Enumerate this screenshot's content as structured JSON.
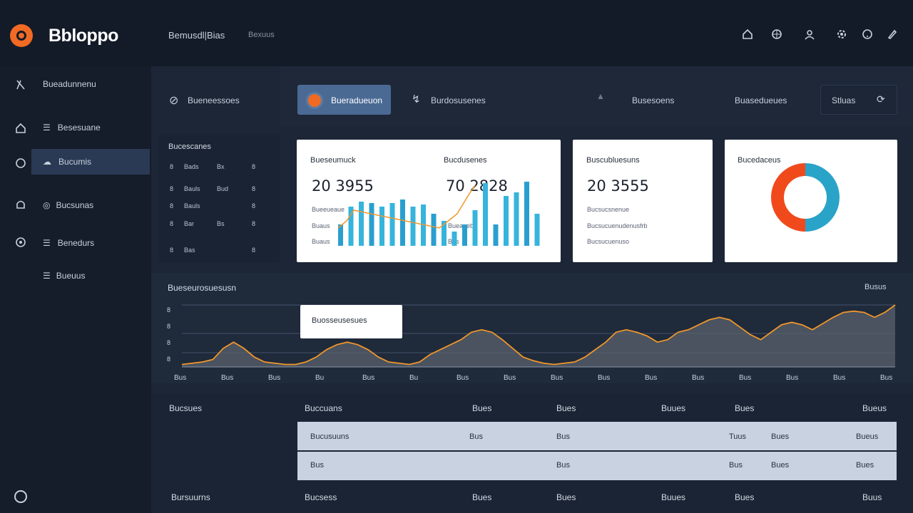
{
  "header": {
    "logo_text": "Bbloppo",
    "breadcrumb": [
      "Bemusdl|Bias",
      "Bexuus"
    ],
    "icons": [
      "home-icon",
      "globe-icon",
      "user-icon",
      "settings-icon",
      "help-icon",
      "edit-icon"
    ]
  },
  "sidebar": {
    "items": [
      {
        "label": "Bueadunnenu",
        "icon": "compass-icon"
      },
      {
        "label": "Besesuane",
        "icon": "home-icon"
      },
      {
        "label": "Bucumis",
        "icon": "cloud-icon"
      },
      {
        "label": "Bucsunas",
        "icon": "bell-icon"
      },
      {
        "label": "Benedurs",
        "icon": "globe-icon"
      },
      {
        "label": "Bueuus",
        "icon": "list-icon"
      }
    ]
  },
  "tabs": {
    "items": [
      "Bueneessoes",
      "Bueradueuon",
      "Burdosusenes",
      "Busesoens",
      "Buasedueues",
      "Stluas"
    ]
  },
  "list_panel": {
    "title": "Bucescanes",
    "rows": [
      [
        "8",
        "Bads",
        "Bx",
        "8"
      ],
      [
        "8",
        "Bauls",
        "Bud",
        "8"
      ],
      [
        "8",
        "Bauls",
        "",
        "8"
      ],
      [
        "8",
        "Bar",
        "Bs",
        "8"
      ],
      [
        "8",
        "Bas",
        "",
        "8"
      ]
    ]
  },
  "cards": {
    "metric_1": {
      "label": "Bueseumuck",
      "value": "20 3955",
      "subs": [
        "Bueeueaue",
        "Buaus",
        "Buaus"
      ]
    },
    "metric_2": {
      "label": "Bucdusenes",
      "value": "70 2828",
      "subs": [
        "Bueaueb",
        "Bus"
      ]
    },
    "metric_3": {
      "label": "Buscubluesuns",
      "value": "20 3555",
      "subs": [
        "Bucsucsnenue",
        "Bucsucuenudenusfrb",
        "Bucsucuenuso"
      ]
    },
    "donut": {
      "label": "Bucedaceus"
    }
  },
  "bar_chart": {
    "values": [
      0.3,
      0.55,
      0.62,
      0.6,
      0.55,
      0.6,
      0.65,
      0.55,
      0.58,
      0.45,
      0.35,
      0.2,
      0.3,
      0.5,
      0.88,
      0.3,
      0.7,
      0.75,
      0.9,
      0.45
    ]
  },
  "donut_chart": {
    "slices": [
      {
        "value": 50,
        "color": "#2aa3c9"
      },
      {
        "value": 50,
        "color": "#f04a1c"
      }
    ]
  },
  "area_chart": {
    "title": "Bueseurosuesusn",
    "right_label": "Busus",
    "tooltip": "Buosseusesues",
    "y_labels": [
      "8",
      "8",
      "8",
      "8"
    ],
    "x_labels": [
      "Bus",
      "Bus",
      "Bus",
      "Bu",
      "Bus",
      "Bu",
      "Bus",
      "Bus",
      "Bus",
      "Bus",
      "Bus",
      "Bus",
      "Bus",
      "Bus",
      "Bus",
      "Bus"
    ],
    "values": [
      2,
      3,
      4,
      6,
      15,
      20,
      15,
      8,
      4,
      3,
      2,
      2,
      4,
      8,
      14,
      18,
      20,
      18,
      14,
      8,
      4,
      3,
      2,
      4,
      10,
      14,
      18,
      22,
      28,
      30,
      28,
      22,
      15,
      8,
      5,
      3,
      2,
      3,
      4,
      8,
      14,
      20,
      28,
      30,
      28,
      25,
      20,
      22,
      28,
      30,
      34,
      38,
      40,
      38,
      32,
      26,
      22,
      28,
      34,
      36,
      34,
      30,
      35,
      40,
      44,
      45,
      44,
      40,
      44,
      50
    ],
    "colors": {
      "line": "#f0962a",
      "fill": "#5a616c"
    }
  },
  "table": {
    "side_labels": [
      "Bucsues",
      "Bursuurns"
    ],
    "headers": [
      "Buccuans",
      "Bues",
      "Bues",
      "Buues",
      "Bues",
      "Bueus"
    ],
    "rows": [
      [
        "Bucusuuns",
        "Bus",
        "Bus",
        "Tuus",
        "Bues",
        "Bueus"
      ],
      [
        "Bus",
        "",
        "Bus",
        "Bus",
        "Bues",
        "Bues"
      ]
    ],
    "footer": [
      "Bucsess",
      "Bues",
      "Bues",
      "Buues",
      "Bues",
      "Buus"
    ]
  }
}
